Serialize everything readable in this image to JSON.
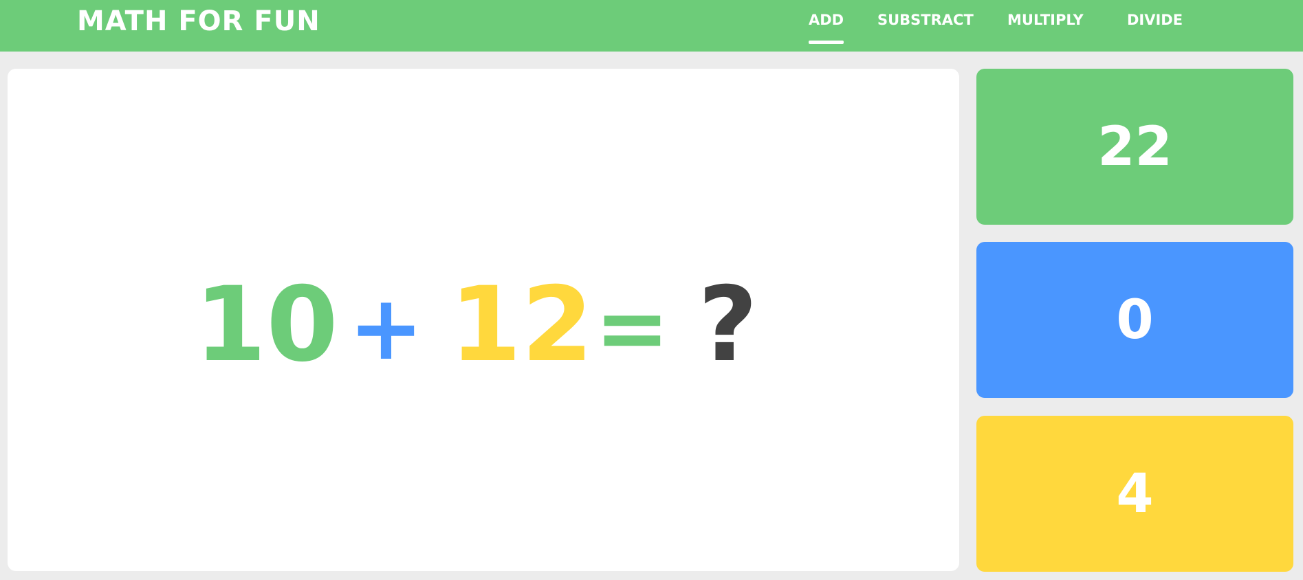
{
  "app": {
    "title": "MATH FOR FUN"
  },
  "nav": {
    "items": [
      {
        "label": "ADD",
        "active": true
      },
      {
        "label": "SUBSTRACT",
        "active": false
      },
      {
        "label": "MULTIPLY",
        "active": false
      },
      {
        "label": "DIVIDE",
        "active": false
      }
    ]
  },
  "question": {
    "operand_a": "10",
    "operator": "+",
    "operand_b": "12",
    "equals": "=",
    "unknown": "?"
  },
  "answers": [
    {
      "value": "22",
      "color": "#6dcc79"
    },
    {
      "value": "0",
      "color": "#4a96ff"
    },
    {
      "value": "4",
      "color": "#ffd83d"
    }
  ],
  "colors": {
    "header": "#6dcc79",
    "green": "#6dcc79",
    "blue": "#4a96ff",
    "yellow": "#ffd83d",
    "dark": "#424242",
    "page_background": "#ececec"
  }
}
